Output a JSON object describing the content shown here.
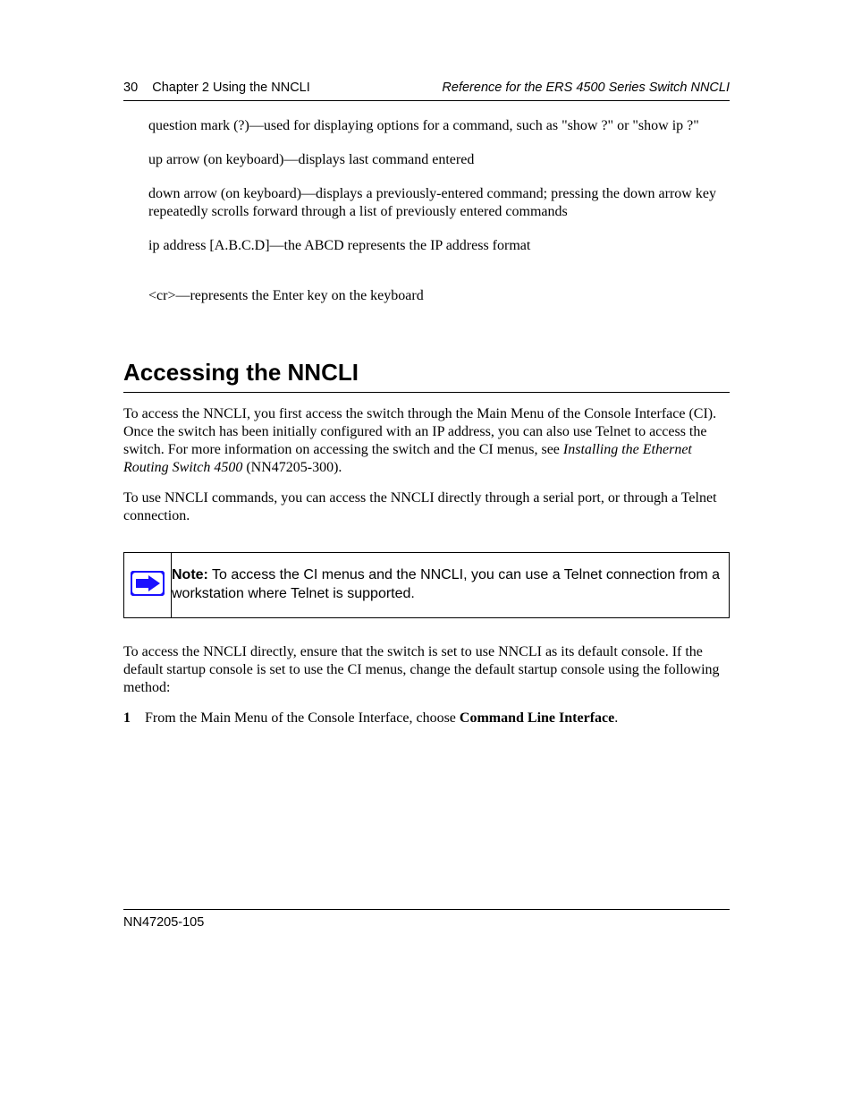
{
  "header": {
    "page_number": "30",
    "chapter_label": "Chapter 2 Using the NNCLI",
    "doc_title": "Reference for the ERS 4500 Series Switch NNCLI"
  },
  "items": [
    "question mark (?)—used for displaying options for a command, such as \"show ?\" or \"show ip ?\"",
    "up arrow (on keyboard)—displays last command entered",
    "down arrow (on keyboard)—displays a previously-entered command; pressing the down arrow key repeatedly scrolls forward through a list of previously entered commands",
    "ip address [A.B.C.D]—the ABCD represents the IP address format",
    "<cr>—represents the Enter key on the keyboard"
  ],
  "section_heading": "Accessing the NNCLI",
  "paragraphs": {
    "p1_pre": "To access the NNCLI, you first access the switch through the Main Menu of the Console Interface (CI). Once the switch has been initially configured with an IP address, you can also use Telnet to access the switch. For more information on accessing the switch and the CI menus, see ",
    "p1_italic": "Installing the Ethernet Routing Switch 4500",
    "p1_post": "  ",
    "p1_post2": " (NN47205-300).",
    "p2": "To use NNCLI commands, you can access the NNCLI directly through a serial port, or through a Telnet connection."
  },
  "note": {
    "label": "Note:",
    "text": " To access the CI menus and the NNCLI, you can use a Telnet connection from a workstation where Telnet is supported."
  },
  "post_note": {
    "p1": "To access the NNCLI directly, ensure that the switch is set to use NNCLI as its default console. If the default startup console is set to use the CI menus, change the default startup console using the following method:",
    "list_item_1_prefix": "1",
    "list_item_1_text_pre": "From the Main Menu of the Console Interface, choose ",
    "list_item_1_bold": "Command Line Interface",
    "list_item_1_text_post": "."
  },
  "footer": {
    "doc_id": "NN47205-105"
  }
}
